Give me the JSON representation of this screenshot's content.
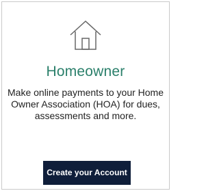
{
  "card": {
    "icon": "house-icon",
    "title": "Homeowner",
    "description": "Make online payments to your Home Owner Association (HOA) for dues, assessments and more.",
    "button_label": "Create your Account"
  },
  "colors": {
    "title": "#2a7f6a",
    "button_bg": "#0f1e3a",
    "border": "#c9c9c9"
  }
}
